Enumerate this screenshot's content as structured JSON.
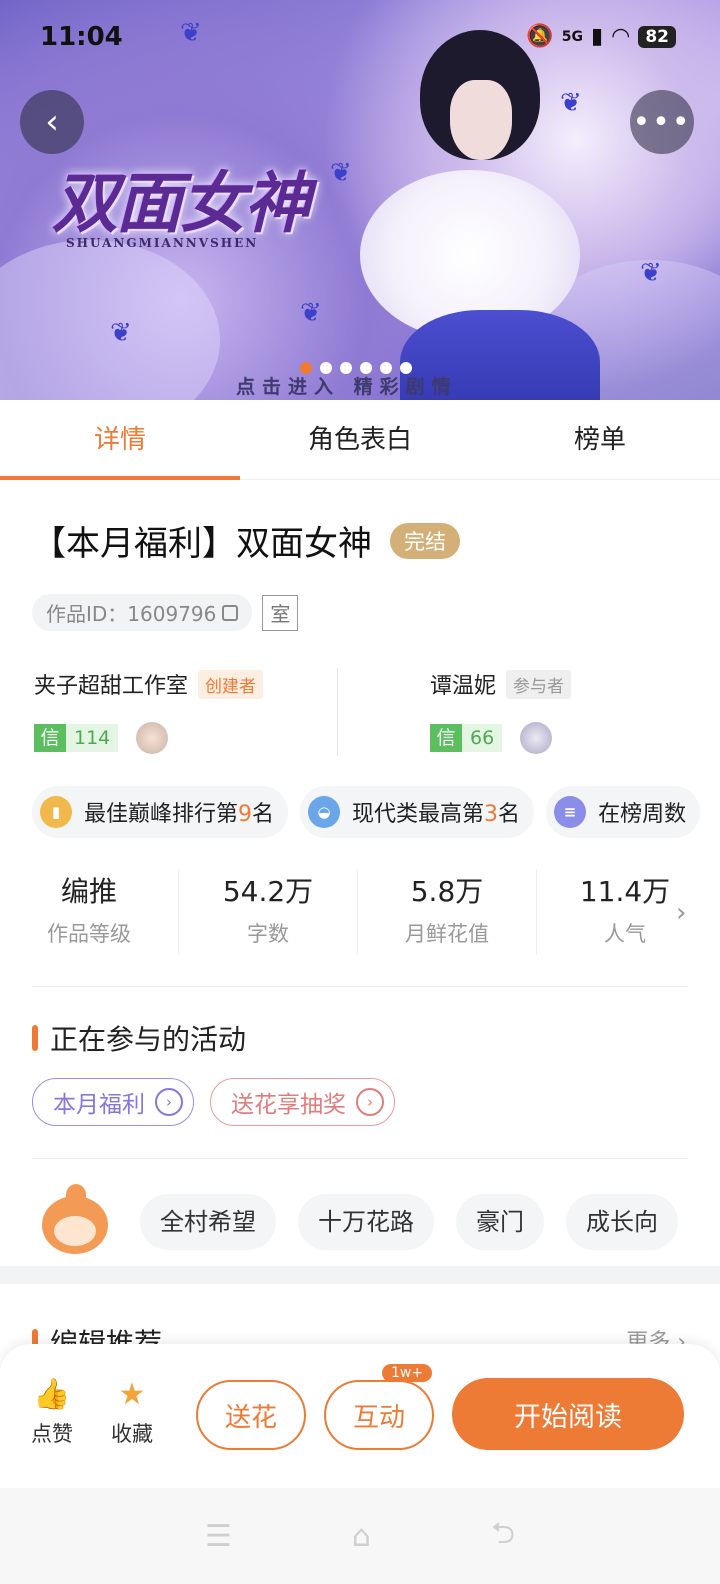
{
  "status_bar": {
    "time": "11:04",
    "signal": "5G",
    "battery": "82"
  },
  "banner": {
    "logo_text": "双面女神",
    "logo_subtitle": "SHUANGMIANNVSHEN",
    "enter_text": "点击进入 精彩剧情",
    "carousel_count": 6,
    "carousel_active": 0
  },
  "tabs": [
    {
      "label": "详情",
      "active": true
    },
    {
      "label": "角色表白",
      "active": false
    },
    {
      "label": "榜单",
      "active": false
    }
  ],
  "work": {
    "title": "【本月福利】双面女神",
    "status_badge": "完结",
    "id_label": "作品ID：1609796",
    "room_label": "室"
  },
  "creators": [
    {
      "name": "夹子超甜工作室",
      "role": "创建者",
      "trust_label": "信",
      "trust_value": "114"
    },
    {
      "name": "谭温妮",
      "role": "参与者",
      "trust_label": "信",
      "trust_value": "66"
    }
  ],
  "ranks": [
    {
      "prefix": "最佳巅峰排行第",
      "number": "9",
      "suffix": "名",
      "icon": "chart-icon",
      "color": "#f2b84b"
    },
    {
      "prefix": "现代类最高第",
      "number": "3",
      "suffix": "名",
      "icon": "bag-icon",
      "color": "#6aa6e8"
    },
    {
      "prefix": "在榜周数",
      "number": "",
      "suffix": "",
      "icon": "list-icon",
      "color": "#8b8ee8"
    }
  ],
  "stats": [
    {
      "value": "编推",
      "label": "作品等级"
    },
    {
      "value": "54.2万",
      "label": "字数"
    },
    {
      "value": "5.8万",
      "label": "月鲜花值"
    },
    {
      "value": "11.4万",
      "label": "人气"
    }
  ],
  "activities": {
    "title": "正在参与的活动",
    "items": [
      {
        "label": "本月福利"
      },
      {
        "label": "送花享抽奖"
      }
    ]
  },
  "tags": [
    "全村希望",
    "十万花路",
    "豪门",
    "成长向"
  ],
  "editor_section": {
    "title": "编辑推荐",
    "more": "更多"
  },
  "action_bar": {
    "like": "点赞",
    "favorite": "收藏",
    "flower": "送花",
    "interact": "互动",
    "interact_badge": "1w+",
    "read": "开始阅读"
  },
  "colors": {
    "accent": "#ed7a35",
    "gold": "#d2b077",
    "trust_green": "#5cbf5f"
  }
}
